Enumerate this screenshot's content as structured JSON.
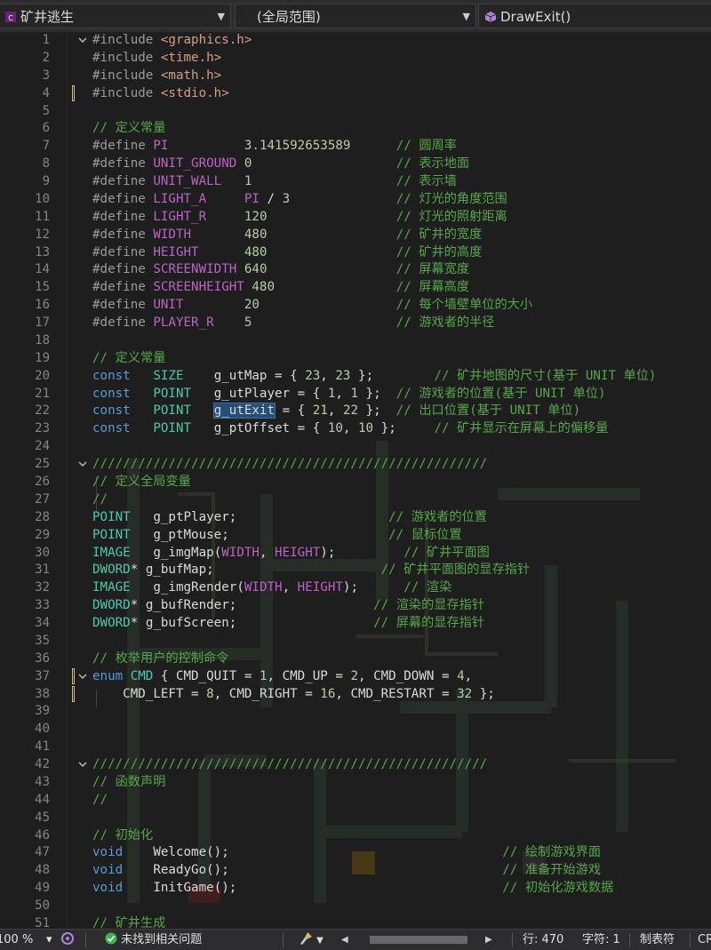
{
  "navbar": {
    "project": "矿井逃生",
    "scope": "(全局范围)",
    "function": "DrawExit()"
  },
  "lines": [
    {
      "n": "1",
      "fold": "open",
      "tokens": [
        {
          "t": "#include ",
          "c": "pp"
        },
        {
          "t": "<graphics.h>",
          "c": "inc"
        }
      ]
    },
    {
      "n": "2",
      "tokens": [
        {
          "t": "#include ",
          "c": "pp"
        },
        {
          "t": "<time.h>",
          "c": "inc"
        }
      ]
    },
    {
      "n": "3",
      "tokens": [
        {
          "t": "#include ",
          "c": "pp"
        },
        {
          "t": "<math.h>",
          "c": "inc"
        }
      ]
    },
    {
      "n": "4",
      "marker": true,
      "tokens": [
        {
          "t": "#include ",
          "c": "pp"
        },
        {
          "t": "<stdio.h>",
          "c": "inc"
        }
      ]
    },
    {
      "n": "5",
      "tokens": []
    },
    {
      "n": "6",
      "tokens": [
        {
          "t": "// 定义常量",
          "c": "cm"
        }
      ]
    },
    {
      "n": "7",
      "tokens": [
        {
          "t": "#define ",
          "c": "pp"
        },
        {
          "t": "PI",
          "c": "macro"
        },
        {
          "t": "          ",
          "c": "plain"
        },
        {
          "t": "3.141592653589",
          "c": "num"
        },
        {
          "t": "      ",
          "c": "plain"
        },
        {
          "t": "// 圆周率",
          "c": "cm"
        }
      ]
    },
    {
      "n": "8",
      "tokens": [
        {
          "t": "#define ",
          "c": "pp"
        },
        {
          "t": "UNIT_GROUND",
          "c": "macro"
        },
        {
          "t": " ",
          "c": "plain"
        },
        {
          "t": "0",
          "c": "num"
        },
        {
          "t": "                   ",
          "c": "plain"
        },
        {
          "t": "// 表示地面",
          "c": "cm"
        }
      ]
    },
    {
      "n": "9",
      "tokens": [
        {
          "t": "#define ",
          "c": "pp"
        },
        {
          "t": "UNIT_WALL",
          "c": "macro"
        },
        {
          "t": "   ",
          "c": "plain"
        },
        {
          "t": "1",
          "c": "num"
        },
        {
          "t": "                   ",
          "c": "plain"
        },
        {
          "t": "// 表示墙",
          "c": "cm"
        }
      ]
    },
    {
      "n": "10",
      "tokens": [
        {
          "t": "#define ",
          "c": "pp"
        },
        {
          "t": "LIGHT_A",
          "c": "macro"
        },
        {
          "t": "     ",
          "c": "plain"
        },
        {
          "t": "PI",
          "c": "macro"
        },
        {
          "t": " / ",
          "c": "plain"
        },
        {
          "t": "3",
          "c": "num"
        },
        {
          "t": "              ",
          "c": "plain"
        },
        {
          "t": "// 灯光的角度范围",
          "c": "cm"
        }
      ]
    },
    {
      "n": "11",
      "tokens": [
        {
          "t": "#define ",
          "c": "pp"
        },
        {
          "t": "LIGHT_R",
          "c": "macro"
        },
        {
          "t": "     ",
          "c": "plain"
        },
        {
          "t": "120",
          "c": "num"
        },
        {
          "t": "                 ",
          "c": "plain"
        },
        {
          "t": "// 灯光的照射距离",
          "c": "cm"
        }
      ]
    },
    {
      "n": "12",
      "tokens": [
        {
          "t": "#define ",
          "c": "pp"
        },
        {
          "t": "WIDTH",
          "c": "macro"
        },
        {
          "t": "       ",
          "c": "plain"
        },
        {
          "t": "480",
          "c": "num"
        },
        {
          "t": "                 ",
          "c": "plain"
        },
        {
          "t": "// 矿井的宽度",
          "c": "cm"
        }
      ]
    },
    {
      "n": "13",
      "tokens": [
        {
          "t": "#define ",
          "c": "pp"
        },
        {
          "t": "HEIGHT",
          "c": "macro"
        },
        {
          "t": "      ",
          "c": "plain"
        },
        {
          "t": "480",
          "c": "num"
        },
        {
          "t": "                 ",
          "c": "plain"
        },
        {
          "t": "// 矿井的高度",
          "c": "cm"
        }
      ]
    },
    {
      "n": "14",
      "tokens": [
        {
          "t": "#define ",
          "c": "pp"
        },
        {
          "t": "SCREENWIDTH",
          "c": "macro"
        },
        {
          "t": " ",
          "c": "plain"
        },
        {
          "t": "640",
          "c": "num"
        },
        {
          "t": "                 ",
          "c": "plain"
        },
        {
          "t": "// 屏幕宽度",
          "c": "cm"
        }
      ]
    },
    {
      "n": "15",
      "tokens": [
        {
          "t": "#define ",
          "c": "pp"
        },
        {
          "t": "SCREENHEIGHT",
          "c": "macro"
        },
        {
          "t": " ",
          "c": "plain"
        },
        {
          "t": "480",
          "c": "num"
        },
        {
          "t": "                ",
          "c": "plain"
        },
        {
          "t": "// 屏幕高度",
          "c": "cm"
        }
      ]
    },
    {
      "n": "16",
      "tokens": [
        {
          "t": "#define ",
          "c": "pp"
        },
        {
          "t": "UNIT",
          "c": "macro"
        },
        {
          "t": "        ",
          "c": "plain"
        },
        {
          "t": "20",
          "c": "num"
        },
        {
          "t": "                  ",
          "c": "plain"
        },
        {
          "t": "// 每个墙壁单位的大小",
          "c": "cm"
        }
      ]
    },
    {
      "n": "17",
      "tokens": [
        {
          "t": "#define ",
          "c": "pp"
        },
        {
          "t": "PLAYER_R",
          "c": "macro"
        },
        {
          "t": "    ",
          "c": "plain"
        },
        {
          "t": "5",
          "c": "num"
        },
        {
          "t": "                   ",
          "c": "plain"
        },
        {
          "t": "// 游戏者的半径",
          "c": "cm"
        }
      ]
    },
    {
      "n": "18",
      "tokens": []
    },
    {
      "n": "19",
      "tokens": [
        {
          "t": "// 定义常量",
          "c": "cm"
        }
      ]
    },
    {
      "n": "20",
      "tokens": [
        {
          "t": "const",
          "c": "kw"
        },
        {
          "t": "   ",
          "c": "plain"
        },
        {
          "t": "SIZE",
          "c": "type"
        },
        {
          "t": "    ",
          "c": "plain"
        },
        {
          "t": "g_utMap",
          "c": "var"
        },
        {
          "t": " = { ",
          "c": "plain"
        },
        {
          "t": "23",
          "c": "num"
        },
        {
          "t": ", ",
          "c": "plain"
        },
        {
          "t": "23",
          "c": "num"
        },
        {
          "t": " };        ",
          "c": "plain"
        },
        {
          "t": "// 矿井地图的尺寸(基于 UNIT 单位)",
          "c": "cm"
        }
      ]
    },
    {
      "n": "21",
      "tokens": [
        {
          "t": "const",
          "c": "kw"
        },
        {
          "t": "   ",
          "c": "plain"
        },
        {
          "t": "POINT",
          "c": "type"
        },
        {
          "t": "   ",
          "c": "plain"
        },
        {
          "t": "g_utPlayer",
          "c": "var"
        },
        {
          "t": " = { ",
          "c": "plain"
        },
        {
          "t": "1",
          "c": "num"
        },
        {
          "t": ", ",
          "c": "plain"
        },
        {
          "t": "1",
          "c": "num"
        },
        {
          "t": " };  ",
          "c": "plain"
        },
        {
          "t": "// 游戏者的位置(基于 UNIT 单位)",
          "c": "cm"
        }
      ]
    },
    {
      "n": "22",
      "tokens": [
        {
          "t": "const",
          "c": "kw"
        },
        {
          "t": "   ",
          "c": "plain"
        },
        {
          "t": "POINT",
          "c": "type"
        },
        {
          "t": "   ",
          "c": "plain"
        },
        {
          "t": "g_utExit",
          "c": "var",
          "hl": true
        },
        {
          "t": " = { ",
          "c": "plain"
        },
        {
          "t": "21",
          "c": "num"
        },
        {
          "t": ", ",
          "c": "plain"
        },
        {
          "t": "22",
          "c": "num"
        },
        {
          "t": " };  ",
          "c": "plain"
        },
        {
          "t": "// 出口位置(基于 UNIT 单位)",
          "c": "cm"
        }
      ]
    },
    {
      "n": "23",
      "tokens": [
        {
          "t": "const",
          "c": "kw"
        },
        {
          "t": "   ",
          "c": "plain"
        },
        {
          "t": "POINT",
          "c": "type"
        },
        {
          "t": "   ",
          "c": "plain"
        },
        {
          "t": "g_ptOffset",
          "c": "var"
        },
        {
          "t": " = { ",
          "c": "plain"
        },
        {
          "t": "10",
          "c": "num"
        },
        {
          "t": ", ",
          "c": "plain"
        },
        {
          "t": "10",
          "c": "num"
        },
        {
          "t": " };     ",
          "c": "plain"
        },
        {
          "t": "// 矿井显示在屏幕上的偏移量",
          "c": "cm"
        }
      ]
    },
    {
      "n": "24",
      "tokens": []
    },
    {
      "n": "25",
      "fold": "open",
      "tokens": [
        {
          "t": "////////////////////////////////////////////////////",
          "c": "cm"
        }
      ]
    },
    {
      "n": "26",
      "tokens": [
        {
          "t": "// 定义全局变量",
          "c": "cm"
        }
      ]
    },
    {
      "n": "27",
      "tokens": [
        {
          "t": "//",
          "c": "cm"
        }
      ]
    },
    {
      "n": "28",
      "tokens": [
        {
          "t": "POINT",
          "c": "type"
        },
        {
          "t": "   ",
          "c": "plain"
        },
        {
          "t": "g_ptPlayer",
          "c": "var"
        },
        {
          "t": ";                    ",
          "c": "plain"
        },
        {
          "t": "// 游戏者的位置",
          "c": "cm"
        }
      ]
    },
    {
      "n": "29",
      "tokens": [
        {
          "t": "POINT",
          "c": "type"
        },
        {
          "t": "   ",
          "c": "plain"
        },
        {
          "t": "g_ptMouse",
          "c": "var"
        },
        {
          "t": ";                     ",
          "c": "plain"
        },
        {
          "t": "// 鼠标位置",
          "c": "cm"
        }
      ]
    },
    {
      "n": "30",
      "tokens": [
        {
          "t": "IMAGE",
          "c": "type"
        },
        {
          "t": "   ",
          "c": "plain"
        },
        {
          "t": "g_imgMap",
          "c": "var"
        },
        {
          "t": "(",
          "c": "plain"
        },
        {
          "t": "WIDTH",
          "c": "macro"
        },
        {
          "t": ", ",
          "c": "plain"
        },
        {
          "t": "HEIGHT",
          "c": "macro"
        },
        {
          "t": ");         ",
          "c": "plain"
        },
        {
          "t": "// 矿井平面图",
          "c": "cm"
        }
      ]
    },
    {
      "n": "31",
      "tokens": [
        {
          "t": "DWORD",
          "c": "type"
        },
        {
          "t": "* ",
          "c": "plain"
        },
        {
          "t": "g_bufMap",
          "c": "var"
        },
        {
          "t": ";                      ",
          "c": "plain"
        },
        {
          "t": "// 矿井平面图的显存指针",
          "c": "cm"
        }
      ]
    },
    {
      "n": "32",
      "tokens": [
        {
          "t": "IMAGE",
          "c": "type"
        },
        {
          "t": "   ",
          "c": "plain"
        },
        {
          "t": "g_imgRender",
          "c": "var"
        },
        {
          "t": "(",
          "c": "plain"
        },
        {
          "t": "WIDTH",
          "c": "macro"
        },
        {
          "t": ", ",
          "c": "plain"
        },
        {
          "t": "HEIGHT",
          "c": "macro"
        },
        {
          "t": ");      ",
          "c": "plain"
        },
        {
          "t": "// 渲染",
          "c": "cm"
        }
      ]
    },
    {
      "n": "33",
      "tokens": [
        {
          "t": "DWORD",
          "c": "type"
        },
        {
          "t": "* ",
          "c": "plain"
        },
        {
          "t": "g_bufRender",
          "c": "var"
        },
        {
          "t": ";                  ",
          "c": "plain"
        },
        {
          "t": "// 渲染的显存指针",
          "c": "cm"
        }
      ]
    },
    {
      "n": "34",
      "tokens": [
        {
          "t": "DWORD",
          "c": "type"
        },
        {
          "t": "* ",
          "c": "plain"
        },
        {
          "t": "g_bufScreen",
          "c": "var"
        },
        {
          "t": ";                  ",
          "c": "plain"
        },
        {
          "t": "// 屏幕的显存指针",
          "c": "cm"
        }
      ]
    },
    {
      "n": "35",
      "tokens": []
    },
    {
      "n": "36",
      "tokens": [
        {
          "t": "// 枚举用户的控制命令",
          "c": "cm"
        }
      ]
    },
    {
      "n": "37",
      "fold": "open",
      "marker": true,
      "tokens": [
        {
          "t": "enum",
          "c": "kw"
        },
        {
          "t": " ",
          "c": "plain"
        },
        {
          "t": "CMD",
          "c": "type"
        },
        {
          "t": " { ",
          "c": "plain"
        },
        {
          "t": "CMD_QUIT",
          "c": "var"
        },
        {
          "t": " = ",
          "c": "plain"
        },
        {
          "t": "1",
          "c": "num"
        },
        {
          "t": ", ",
          "c": "plain"
        },
        {
          "t": "CMD_UP",
          "c": "var"
        },
        {
          "t": " = ",
          "c": "plain"
        },
        {
          "t": "2",
          "c": "num"
        },
        {
          "t": ", ",
          "c": "plain"
        },
        {
          "t": "CMD_DOWN",
          "c": "var"
        },
        {
          "t": " = ",
          "c": "plain"
        },
        {
          "t": "4",
          "c": "num"
        },
        {
          "t": ",",
          "c": "plain"
        }
      ]
    },
    {
      "n": "38",
      "marker": true,
      "tokens": [
        {
          "t": "    ",
          "c": "plain"
        },
        {
          "t": "CMD_LEFT",
          "c": "var"
        },
        {
          "t": " = ",
          "c": "plain"
        },
        {
          "t": "8",
          "c": "num"
        },
        {
          "t": ", ",
          "c": "plain"
        },
        {
          "t": "CMD_RIGHT",
          "c": "var"
        },
        {
          "t": " = ",
          "c": "plain"
        },
        {
          "t": "16",
          "c": "num"
        },
        {
          "t": ", ",
          "c": "plain"
        },
        {
          "t": "CMD_RESTART",
          "c": "var"
        },
        {
          "t": " = ",
          "c": "plain"
        },
        {
          "t": "32",
          "c": "num"
        },
        {
          "t": " };",
          "c": "plain"
        }
      ]
    },
    {
      "n": "39",
      "tokens": []
    },
    {
      "n": "40",
      "tokens": []
    },
    {
      "n": "41",
      "tokens": []
    },
    {
      "n": "42",
      "fold": "open",
      "tokens": [
        {
          "t": "////////////////////////////////////////////////////",
          "c": "cm"
        }
      ]
    },
    {
      "n": "43",
      "tokens": [
        {
          "t": "// 函数声明",
          "c": "cm"
        }
      ]
    },
    {
      "n": "44",
      "tokens": [
        {
          "t": "//",
          "c": "cm"
        }
      ]
    },
    {
      "n": "45",
      "tokens": []
    },
    {
      "n": "46",
      "tokens": [
        {
          "t": "// 初始化",
          "c": "cm"
        }
      ]
    },
    {
      "n": "47",
      "tokens": [
        {
          "t": "void",
          "c": "kw"
        },
        {
          "t": "    ",
          "c": "plain"
        },
        {
          "t": "Welcome",
          "c": "var"
        },
        {
          "t": "();                                    ",
          "c": "plain"
        },
        {
          "t": "// 绘制游戏界面",
          "c": "cm"
        }
      ]
    },
    {
      "n": "48",
      "tokens": [
        {
          "t": "void",
          "c": "kw"
        },
        {
          "t": "    ",
          "c": "plain"
        },
        {
          "t": "ReadyGo",
          "c": "var"
        },
        {
          "t": "();                                    ",
          "c": "plain"
        },
        {
          "t": "// 准备开始游戏",
          "c": "cm"
        }
      ]
    },
    {
      "n": "49",
      "tokens": [
        {
          "t": "void",
          "c": "kw"
        },
        {
          "t": "    ",
          "c": "plain"
        },
        {
          "t": "InitGame",
          "c": "var"
        },
        {
          "t": "();                                   ",
          "c": "plain"
        },
        {
          "t": "// 初始化游戏数据",
          "c": "cm"
        }
      ]
    },
    {
      "n": "50",
      "tokens": []
    },
    {
      "n": "51",
      "tokens": [
        {
          "t": "// 矿井生成",
          "c": "cm"
        }
      ]
    }
  ],
  "status": {
    "zoom": "100 %",
    "issues": "未找到相关问题",
    "line": "行: 470",
    "char": "字符: 1",
    "tabs": "制表符",
    "eol": "CR"
  },
  "colors": {
    "background": "#1e1e1e",
    "keyword": "#569cd6",
    "comment": "#57a64a",
    "type": "#4ec9b0",
    "number": "#b5cea8",
    "macro": "#bd63c5",
    "include": "#d69d85"
  },
  "icons": {
    "project": "cpp-project-icon",
    "function": "method-cube-icon",
    "issues": "check-circle-icon",
    "cleanup": "brush-icon"
  }
}
